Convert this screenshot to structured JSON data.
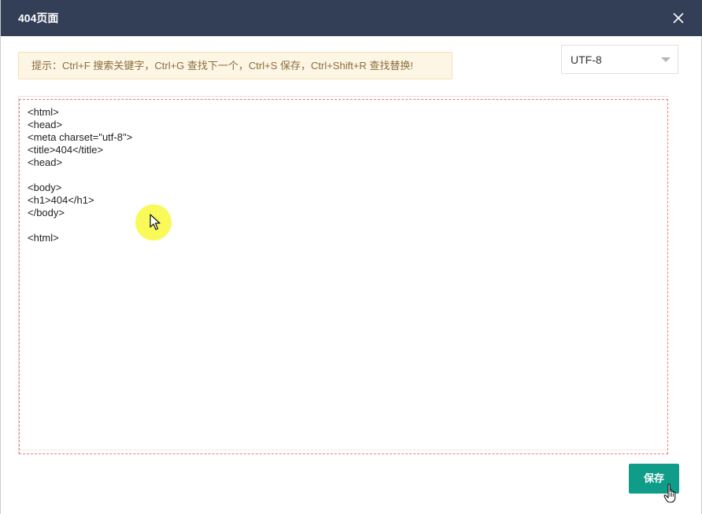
{
  "dialog": {
    "title": "404页面",
    "close_icon": "close-icon"
  },
  "hint": {
    "text": "提示：Ctrl+F 搜索关键字，Ctrl+G 查找下一个，Ctrl+S 保存，Ctrl+Shift+R 查找替换!"
  },
  "encoding": {
    "selected": "UTF-8",
    "icon": "chevron-down-icon"
  },
  "editor": {
    "lines": [
      "<html>",
      "<head>",
      "<meta charset=\"utf-8\">",
      "<title>404</title>",
      "<head>",
      "",
      "<body>",
      "<h1>404</h1>",
      "</body>",
      "",
      "<html>"
    ]
  },
  "footer": {
    "save_label": "保存"
  },
  "colors": {
    "titlebar": "#333f57",
    "save_button": "#0f9d8a",
    "hint_background": "#fdf6e5",
    "hint_text": "#8a6d3b",
    "editor_border": "#f07b7b"
  },
  "cursor": {
    "pointer_icon": "arrow-pointer-icon",
    "hand_icon": "hand-pointer-icon"
  }
}
